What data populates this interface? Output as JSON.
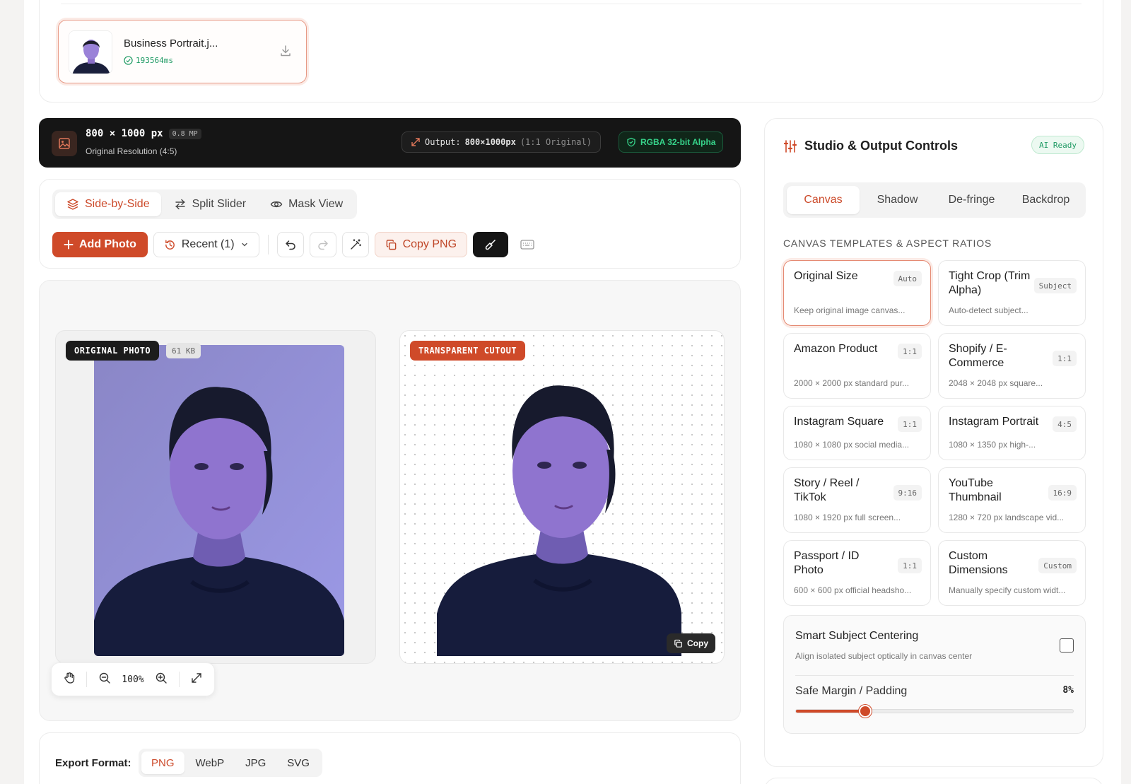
{
  "recent_item": {
    "name": "Business Portrait.j...",
    "time": "193564ms"
  },
  "info": {
    "dims": "800 × 1000 px",
    "mp": "0.8 MP",
    "resolution": "Original Resolution (4:5)",
    "output_label": "Output:",
    "output_value": "800×1000px",
    "output_note": "(1:1 Original)",
    "alpha": "RGBA 32-bit Alpha"
  },
  "view_tabs": [
    {
      "label": "Side-by-Side",
      "icon": "layers-icon",
      "active": true
    },
    {
      "label": "Split Slider",
      "icon": "swap-arrows-icon",
      "active": false
    },
    {
      "label": "Mask View",
      "icon": "eye-icon",
      "active": false
    }
  ],
  "toolbar": {
    "add_photo": "Add Photo",
    "recent": "Recent (1)",
    "copy_png": "Copy PNG"
  },
  "preview": {
    "original_label": "ORIGINAL PHOTO",
    "original_size": "61 KB",
    "cutout_label": "TRANSPARENT CUTOUT",
    "copy_label": "Copy",
    "zoom": "100%"
  },
  "export": {
    "label": "Export Format:",
    "formats": [
      {
        "label": "PNG",
        "active": true
      },
      {
        "label": "WebP",
        "active": false
      },
      {
        "label": "JPG",
        "active": false
      },
      {
        "label": "SVG",
        "active": false
      }
    ]
  },
  "studio": {
    "title": "Studio & Output Controls",
    "badge": "AI Ready",
    "tabs": [
      {
        "label": "Canvas",
        "active": true
      },
      {
        "label": "Shadow",
        "active": false
      },
      {
        "label": "De-fringe",
        "active": false
      },
      {
        "label": "Backdrop",
        "active": false
      }
    ],
    "section_heading": "CANVAS TEMPLATES & ASPECT RATIOS",
    "templates": [
      {
        "name": "Original Size",
        "ratio": "Auto",
        "desc": "Keep original image canvas...",
        "active": true,
        "short": false
      },
      {
        "name": "Tight Crop (Trim Alpha)",
        "ratio": "Subject",
        "desc": "Auto-detect subject...",
        "active": false,
        "short": false
      },
      {
        "name": "Amazon Product",
        "ratio": "1:1",
        "desc": "2000 × 2000 px standard pur...",
        "active": false,
        "short": false
      },
      {
        "name": "Shopify / E-Commerce",
        "ratio": "1:1",
        "desc": "2048 × 2048 px square...",
        "active": false,
        "short": false
      },
      {
        "name": "Instagram Square",
        "ratio": "1:1",
        "desc": "1080 × 1080 px social media...",
        "active": false,
        "short": true
      },
      {
        "name": "Instagram Portrait",
        "ratio": "4:5",
        "desc": "1080 × 1350 px high-...",
        "active": false,
        "short": true
      },
      {
        "name": "Story / Reel / TikTok",
        "ratio": "9:16",
        "desc": "1080 × 1920 px full screen...",
        "active": false,
        "short": false
      },
      {
        "name": "YouTube Thumbnail",
        "ratio": "16:9",
        "desc": "1280 × 720 px landscape vid...",
        "active": false,
        "short": false
      },
      {
        "name": "Passport / ID Photo",
        "ratio": "1:1",
        "desc": "600 × 600 px official headsho...",
        "active": false,
        "short": false
      },
      {
        "name": "Custom Dimensions",
        "ratio": "Custom",
        "desc": "Manually specify custom widt...",
        "active": false,
        "short": false
      }
    ],
    "centering_title": "Smart Subject Centering",
    "centering_desc": "Align isolated subject optically in canvas center",
    "margin_label": "Safe Margin / Padding",
    "margin_value": "8%",
    "margin_fraction": 0.25
  },
  "colors": {
    "accent": "#cf4a29",
    "success": "#1e9a63",
    "dark": "#151515"
  }
}
